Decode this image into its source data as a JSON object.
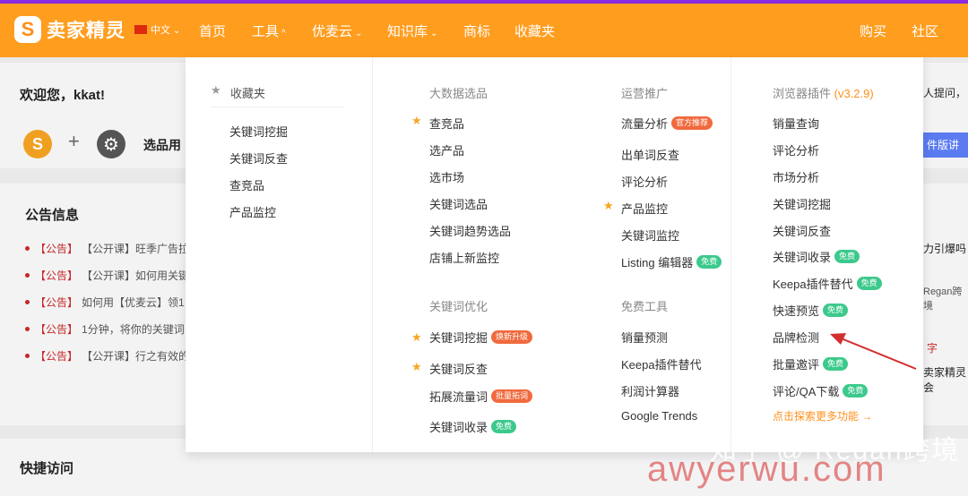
{
  "header": {
    "logo_mark": "S",
    "logo_text": "卖家精灵",
    "lang": "中文",
    "nav": [
      {
        "label": "首页",
        "has_menu": false
      },
      {
        "label": "工具",
        "has_menu": true
      },
      {
        "label": "优麦云",
        "has_menu": true
      },
      {
        "label": "知识库",
        "has_menu": true
      },
      {
        "label": "商标",
        "has_menu": false
      },
      {
        "label": "收藏夹",
        "has_menu": false
      }
    ],
    "right_nav": [
      "购买",
      "社区"
    ]
  },
  "background": {
    "welcome": "欢迎您，kkat!",
    "plus": "+",
    "tool_label": "选品用",
    "announcement_title": "公告信息",
    "announcements": [
      {
        "tag": "【公告】",
        "text": "【公开课】旺季广告拉"
      },
      {
        "tag": "【公告】",
        "text": "【公开课】如何用关键"
      },
      {
        "tag": "【公告】",
        "text": "如何用【优麦云】领1"
      },
      {
        "tag": "【公告】",
        "text": "1分钟，将你的关键词"
      },
      {
        "tag": "【公告】",
        "text": "【公开课】行之有效的"
      }
    ],
    "right_snippets": [
      "人提问，",
      "件版讲解",
      "力引爆吗",
      "Regan跨境",
      "字",
      "卖家精灵会"
    ],
    "quick_access": "快捷访问"
  },
  "dropdown": {
    "favorites": {
      "title": "收藏夹",
      "items": [
        "关键词挖掘",
        "关键词反查",
        "查竞品",
        "产品监控"
      ]
    },
    "big_data": {
      "title": "大数据选品",
      "items": [
        {
          "label": "查竞品",
          "starred": true
        },
        {
          "label": "选产品",
          "starred": false
        },
        {
          "label": "选市场",
          "starred": false
        },
        {
          "label": "关键词选品",
          "starred": false
        },
        {
          "label": "关键词趋势选品",
          "starred": false
        },
        {
          "label": "店铺上新监控",
          "starred": false
        }
      ]
    },
    "keyword_opt": {
      "title": "关键词优化",
      "items": [
        {
          "label": "关键词挖掘",
          "starred": true,
          "badge": "焕新升级",
          "badge_color": "red"
        },
        {
          "label": "关键词反查",
          "starred": true,
          "badge": "",
          "badge_color": ""
        },
        {
          "label": "拓展流量词",
          "starred": false,
          "badge": "批量拓词",
          "badge_color": "red"
        },
        {
          "label": "关键词收录",
          "starred": false,
          "badge": "免费",
          "badge_color": "green"
        }
      ]
    },
    "operations": {
      "title": "运营推广",
      "items": [
        {
          "label": "流量分析",
          "starred": false,
          "badge": "官方推荐",
          "badge_color": "red"
        },
        {
          "label": "出单词反查",
          "starred": false,
          "badge": "",
          "badge_color": ""
        },
        {
          "label": "评论分析",
          "starred": false,
          "badge": "",
          "badge_color": ""
        },
        {
          "label": "产品监控",
          "starred": true,
          "badge": "",
          "badge_color": ""
        },
        {
          "label": "关键词监控",
          "starred": false,
          "badge": "",
          "badge_color": ""
        },
        {
          "label": "Listing 编辑器",
          "starred": false,
          "badge": "免费",
          "badge_color": "green"
        }
      ]
    },
    "free_tools": {
      "title": "免费工具",
      "items": [
        "销量预测",
        "Keepa插件替代",
        "利润计算器",
        "Google Trends"
      ]
    },
    "browser_plugin": {
      "title": "浏览器插件",
      "version": "(v3.2.9)",
      "items": [
        {
          "label": "销量查询",
          "badge": ""
        },
        {
          "label": "评论分析",
          "badge": ""
        },
        {
          "label": "市场分析",
          "badge": ""
        },
        {
          "label": "关键词挖掘",
          "badge": ""
        },
        {
          "label": "关键词反查",
          "badge": ""
        },
        {
          "label": "关键词收录",
          "badge": "免费"
        },
        {
          "label": "Keepa插件替代",
          "badge": "免费"
        },
        {
          "label": "快速预览",
          "badge": "免费"
        },
        {
          "label": "品牌检测",
          "badge": ""
        },
        {
          "label": "批量邀评",
          "badge": "免费"
        },
        {
          "label": "评论/QA下载",
          "badge": "免费"
        }
      ],
      "more": "点击探索更多功能 →"
    }
  },
  "watermark": {
    "line1": "知乎 @ Regan跨境",
    "line2": "awyerwu.com"
  },
  "colors": {
    "header": "#ff9d1f",
    "top_border": "#8a2be2",
    "star": "#f5a623",
    "badge_red": "#f06a3e",
    "badge_green": "#3cc98c",
    "arrow": "#d32f2f"
  }
}
